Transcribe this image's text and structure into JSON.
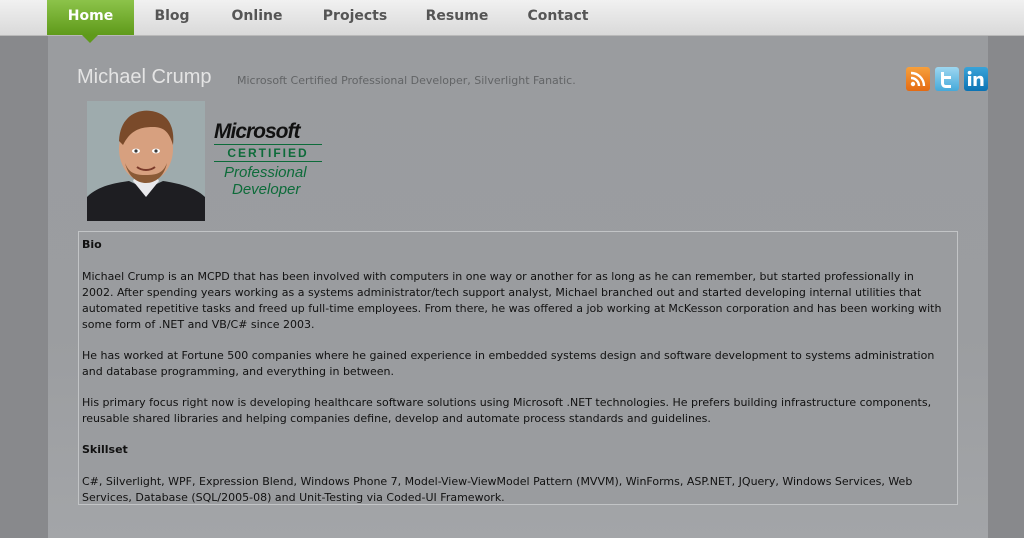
{
  "nav": {
    "items": [
      {
        "label": "Home",
        "active": true
      },
      {
        "label": "Blog"
      },
      {
        "label": "Online"
      },
      {
        "label": "Projects"
      },
      {
        "label": "Resume"
      },
      {
        "label": "Contact"
      }
    ]
  },
  "header": {
    "title": "Michael Crump",
    "tagline": "Microsoft Certified Professional Developer, Silverlight Fanatic."
  },
  "social": {
    "icons": [
      "rss-icon",
      "twitter-icon",
      "linkedin-icon"
    ]
  },
  "badge": {
    "line1": "Microsoft",
    "line2": "CERTIFIED",
    "line3": "Professional",
    "line4": "Developer"
  },
  "bio": {
    "heading": "Bio",
    "paragraphs": [
      "Michael Crump is an MCPD that has been involved with computers in one way or another for as long as he can remember, but started professionally in 2002. After spending years working as a systems administrator/tech support analyst, Michael branched out and started developing internal utilities that automated repetitive tasks and freed up full-time employees. From there, he was offered a job working at McKesson corporation and has been working with some form of .NET and VB/C# since 2003.",
      "He has worked at Fortune 500 companies where he gained experience in embedded systems design and software development to systems administration and database programming, and everything in between.",
      "His primary focus right now is developing healthcare software solutions using Microsoft .NET technologies. He prefers building infrastructure components, reusable shared libraries and helping companies define, develop and automate process standards and guidelines."
    ]
  },
  "skills": {
    "heading": "Skillset",
    "text": "C#, Silverlight, WPF, Expression Blend, Windows Phone 7, Model-View-ViewModel Pattern (MVVM), WinForms, ASP.NET, JQuery, Windows Services, Web Services, Database (SQL/2005-08) and Unit-Testing via Coded-UI Framework."
  },
  "colors": {
    "nav_active": "#6fa82a",
    "ms_green": "#0d6b3a",
    "rss": "#ee7b1e",
    "twitter": "#5bbbe6",
    "linkedin": "#0b73b4"
  }
}
